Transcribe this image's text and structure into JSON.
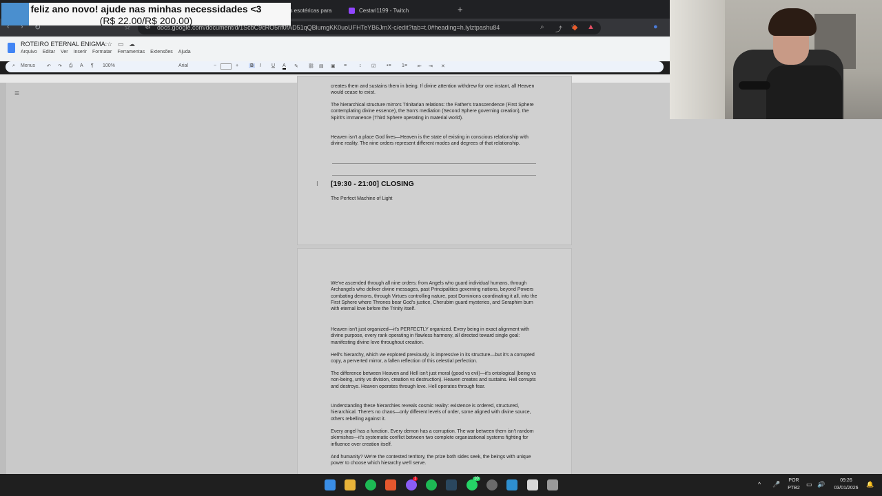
{
  "browser": {
    "tabs": [
      {
        "label": "es esotéricas para"
      },
      {
        "label": "Cestari1199 - Twitch"
      }
    ],
    "new_tab_symbol": "+",
    "url": "docs.google.com/document/d/1ScbC9cRO5nf0fAD51qQBlumgKK0uoUFHTeYB6JmX-c/edit?tab=t.0#heading=h.lylztpashu84"
  },
  "donation": {
    "message": "feliz ano novo! ajude nas minhas necessidades <3",
    "amount": "(R$ 22.00/R$ 200.00)"
  },
  "docs": {
    "title": "ROTEIRO ETERNAL ENIGMA:",
    "menu": [
      "Arquivo",
      "Editar",
      "Ver",
      "Inserir",
      "Formatar",
      "Ferramentas",
      "Extensões",
      "Ajuda"
    ],
    "toolbar": {
      "menus_label": "Menus",
      "zoom": "100%",
      "font": "Arial"
    },
    "page1": {
      "para0": "creates them and sustains them in being. If divine attention withdrew for one instant, all Heaven would cease to exist.",
      "para1": "The hierarchical structure mirrors Trinitarian relations: the Father's transcendence (First Sphere contemplating divine essence), the Son's mediation (Second Sphere governing creation), the Spirit's immanence (Third Sphere operating in material world).",
      "para2": "Heaven isn't a place God lives—Heaven is the state of existing in conscious relationship with divine reality. The nine orders represent different modes and degrees of that relationship.",
      "heading": "[19:30 - 21:00] CLOSING",
      "subheading": "The Perfect Machine of Light"
    },
    "page2": {
      "p1": "We've ascended through all nine orders: from Angels who guard individual humans, through Archangels who deliver divine messages, past Principalities governing nations, beyond Powers combating demons, through Virtues controlling nature, past Dominions coordinating it all, into the First Sphere where Thrones bear God's justice, Cherubim guard mysteries, and Seraphim burn with eternal love before the Trinity itself.",
      "p2": "Heaven isn't just organized—it's PERFECTLY organized. Every being in exact alignment with divine purpose, every rank operating in flawless harmony, all directed toward single goal: manifesting divine love throughout creation.",
      "p3": "Hell's hierarchy, which we explored previously, is impressive in its structure—but it's a corrupted copy, a perverted mirror, a fallen reflection of this celestial perfection.",
      "p4": "The difference between Heaven and Hell isn't just moral (good vs evil)—it's ontological (being vs non-being, unity vs division, creation vs destruction). Heaven creates and sustains. Hell corrupts and destroys. Heaven operates through love. Hell operates through fear.",
      "p5": "Understanding these hierarchies reveals cosmic reality: existence is ordered, structured, hierarchical. There's no chaos—only different levels of order, some aligned with divine source, others rebelling against it.",
      "p6": "Every angel has a function. Every demon has a corruption. The war between them isn't random skirmishes—it's systematic conflict between two complete organizational systems fighting for influence over creation itself.",
      "p7": "And humanity? We're the contested territory, the prize both sides seek, the beings with unique power to choose which hierarchy we'll serve."
    }
  },
  "taskbar": {
    "language": "POR",
    "keyboard": "PTB2",
    "time": "09:26",
    "date": "03/01/2026",
    "badges": {
      "messenger": "1",
      "whatsapp": "10"
    }
  }
}
